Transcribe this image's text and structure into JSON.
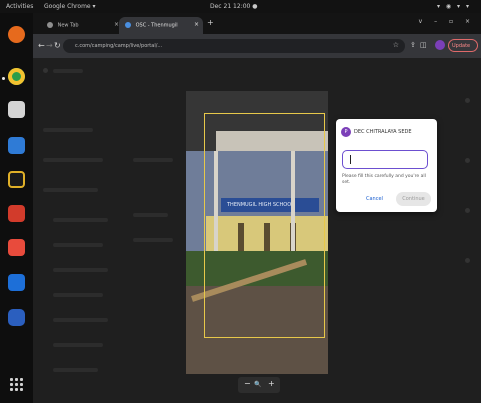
{
  "topbar": {
    "activities": "Activities",
    "app_menu": "Google Chrome ▾",
    "clock": "Dec 21 12:00 ●",
    "tray": "▾ ◉ ▾ ▾"
  },
  "browser": {
    "tabs": [
      {
        "label": "New Tab"
      },
      {
        "label": "OSC - Thenmugil"
      }
    ],
    "new_tab": "+",
    "window_controls": "v – ▫ ×",
    "url": "c.com/camping/camp/live/portal/...",
    "update_label": "Update"
  },
  "viewer": {
    "banner_text": "THENMUGIL HIGH SCHOOL",
    "zoom_out": "−",
    "zoom_icon": "🔍",
    "zoom_in": "+"
  },
  "dialog": {
    "avatar_letter": "P",
    "title": "DEC CHITRALAYA SEDE",
    "input_value": "",
    "help_text": "Please fill this carefully and you're all set.",
    "cancel_label": "Cancel",
    "continue_label": "Continue"
  },
  "colors": {
    "accent_purple": "#7b3fb8",
    "crop_frame": "#e7c84a",
    "input_focus": "#6c4fd0",
    "link_blue": "#1a5fd0"
  }
}
